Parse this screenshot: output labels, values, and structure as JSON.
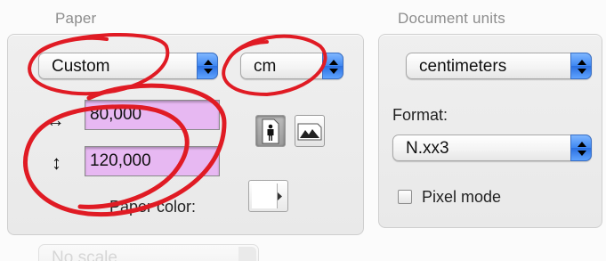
{
  "paper": {
    "title": "Paper",
    "size_popup": {
      "value": "Custom"
    },
    "unit_popup": {
      "value": "cm"
    },
    "width": {
      "value": "80,000"
    },
    "height": {
      "value": "120,000"
    },
    "paper_color": {
      "label": "Paper color:",
      "color": "#ffffff"
    }
  },
  "document_units": {
    "title": "Document units",
    "units_popup": {
      "value": "centimeters"
    },
    "format": {
      "label": "Format:",
      "value": "N.xx3"
    },
    "pixel_mode": {
      "label": "Pixel mode",
      "checked": false
    }
  },
  "scale_popup": {
    "value": "No scale"
  },
  "colors": {
    "accent": "#3e87f2",
    "field_highlight": "#e7b8f2",
    "annotation_red": "#e01b24"
  }
}
